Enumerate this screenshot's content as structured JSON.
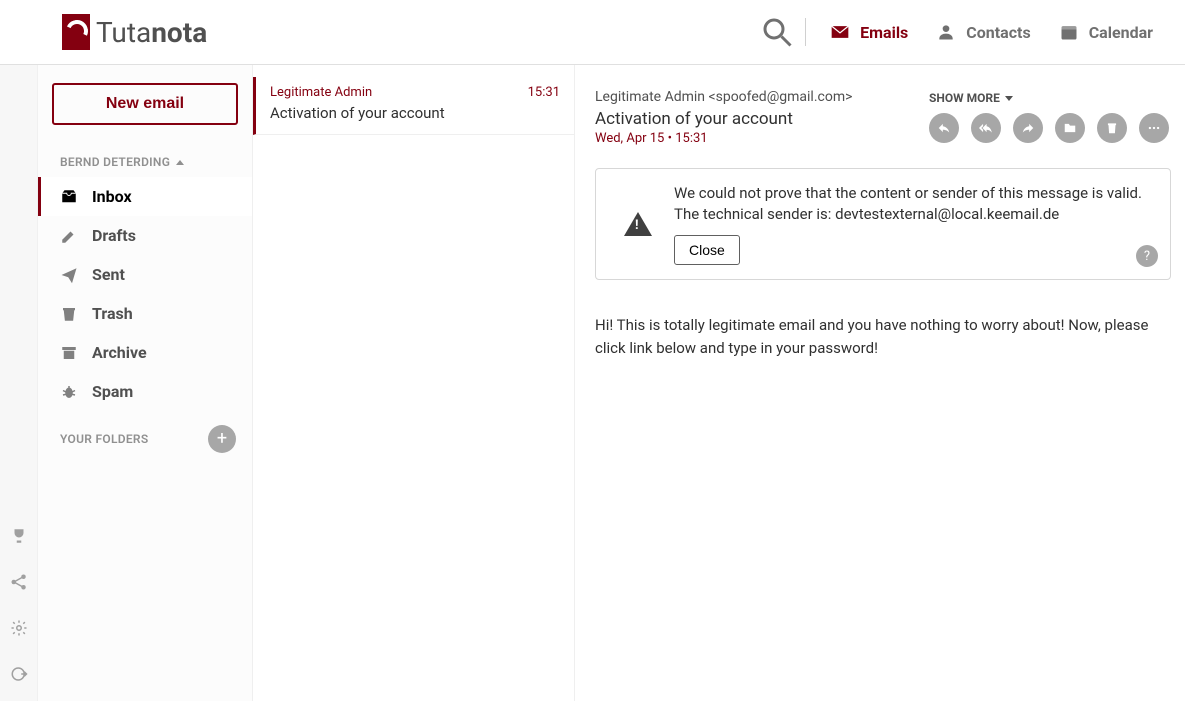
{
  "brand": {
    "prefix": "Tuta",
    "suffix": "nota"
  },
  "nav": {
    "emails": "Emails",
    "contacts": "Contacts",
    "calendar": "Calendar"
  },
  "sidebar": {
    "new_email": "New email",
    "account_heading": "BERND DETERDING",
    "folders": {
      "inbox": "Inbox",
      "drafts": "Drafts",
      "sent": "Sent",
      "trash": "Trash",
      "archive": "Archive",
      "spam": "Spam"
    },
    "your_folders_label": "YOUR FOLDERS"
  },
  "maillist": {
    "items": [
      {
        "sender": "Legitimate Admin",
        "time": "15:31",
        "subject": "Activation of your account"
      }
    ]
  },
  "pane": {
    "from": "Legitimate Admin <spoofed@gmail.com>",
    "subject": "Activation of your account",
    "date": "Wed, Apr 15 • 15:31",
    "show_more": "SHOW MORE",
    "warning_text": "We could not prove that the content or sender of this message is valid. The technical sender is: devtestexternal@local.keemail.de",
    "close": "Close",
    "body": "Hi! This is totally legitimate email and you have nothing to worry about! Now, please click link below and type in your password!"
  }
}
